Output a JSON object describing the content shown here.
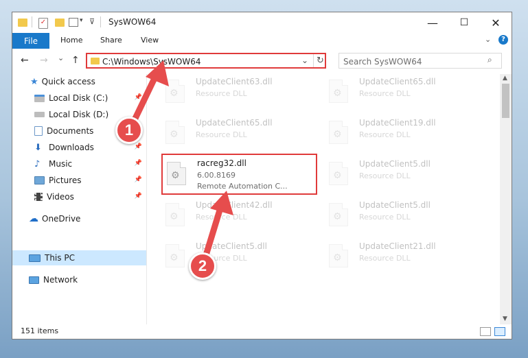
{
  "window": {
    "title": "SysWOW64",
    "controls": {
      "minimize": "—",
      "maximize": "☐",
      "close": "✕"
    }
  },
  "ribbon": {
    "tabs": [
      "File",
      "Home",
      "Share",
      "View"
    ],
    "expand_icon": "chevron-down-icon",
    "help_icon": "help-icon"
  },
  "nav": {
    "back": "←",
    "forward": "→",
    "recent": "⌄",
    "up": "↑",
    "address": "C:\\Windows\\SysWOW64",
    "search_placeholder": "Search SysWOW64"
  },
  "sidebar": {
    "items": [
      {
        "label": "Quick access",
        "icon": "star-icon",
        "pinned": false
      },
      {
        "label": "Local Disk (C:)",
        "icon": "drive-icon",
        "pinned": true
      },
      {
        "label": "Local Disk (D:)",
        "icon": "drive-icon",
        "pinned": true
      },
      {
        "label": "Documents",
        "icon": "documents-icon",
        "pinned": true
      },
      {
        "label": "Downloads",
        "icon": "downloads-icon",
        "pinned": true
      },
      {
        "label": "Music",
        "icon": "music-icon",
        "pinned": true
      },
      {
        "label": "Pictures",
        "icon": "pictures-icon",
        "pinned": true
      },
      {
        "label": "Videos",
        "icon": "videos-icon",
        "pinned": true
      },
      {
        "label": "OneDrive",
        "icon": "cloud-icon",
        "pinned": false
      },
      {
        "label": "This PC",
        "icon": "computer-icon",
        "pinned": false
      },
      {
        "label": "Network",
        "icon": "network-icon",
        "pinned": false
      }
    ]
  },
  "files": [
    {
      "name": "UpdateClient63.dll",
      "line1": "Resource DLL",
      "line2": ""
    },
    {
      "name": "UpdateClient65.dll",
      "line1": "Resource DLL",
      "line2": ""
    },
    {
      "name": "UpdateClient65.dll",
      "line1": "Resource DLL",
      "line2": ""
    },
    {
      "name": "UpdateClient19.dll",
      "line1": "Resource DLL",
      "line2": ""
    },
    {
      "name": "racreg32.dll",
      "line1": "6.00.8169",
      "line2": "Remote Automation C..."
    },
    {
      "name": "UpdateClient5.dll",
      "line1": "Resource DLL",
      "line2": ""
    },
    {
      "name": "UpdateClient42.dll",
      "line1": "Resource DLL",
      "line2": ""
    },
    {
      "name": "UpdateClient5.dll",
      "line1": "Resource DLL",
      "line2": ""
    },
    {
      "name": "UpdateClient5.dll",
      "line1": "Resource DLL",
      "line2": ""
    },
    {
      "name": "UpdateClient21.dll",
      "line1": "Resource DLL",
      "line2": ""
    }
  ],
  "status": {
    "items": "151 items"
  },
  "annotations": {
    "step1": "1",
    "step2": "2"
  },
  "colors": {
    "accent": "#1979ca",
    "highlight": "#e03a3a",
    "selected": "#cce8ff"
  }
}
